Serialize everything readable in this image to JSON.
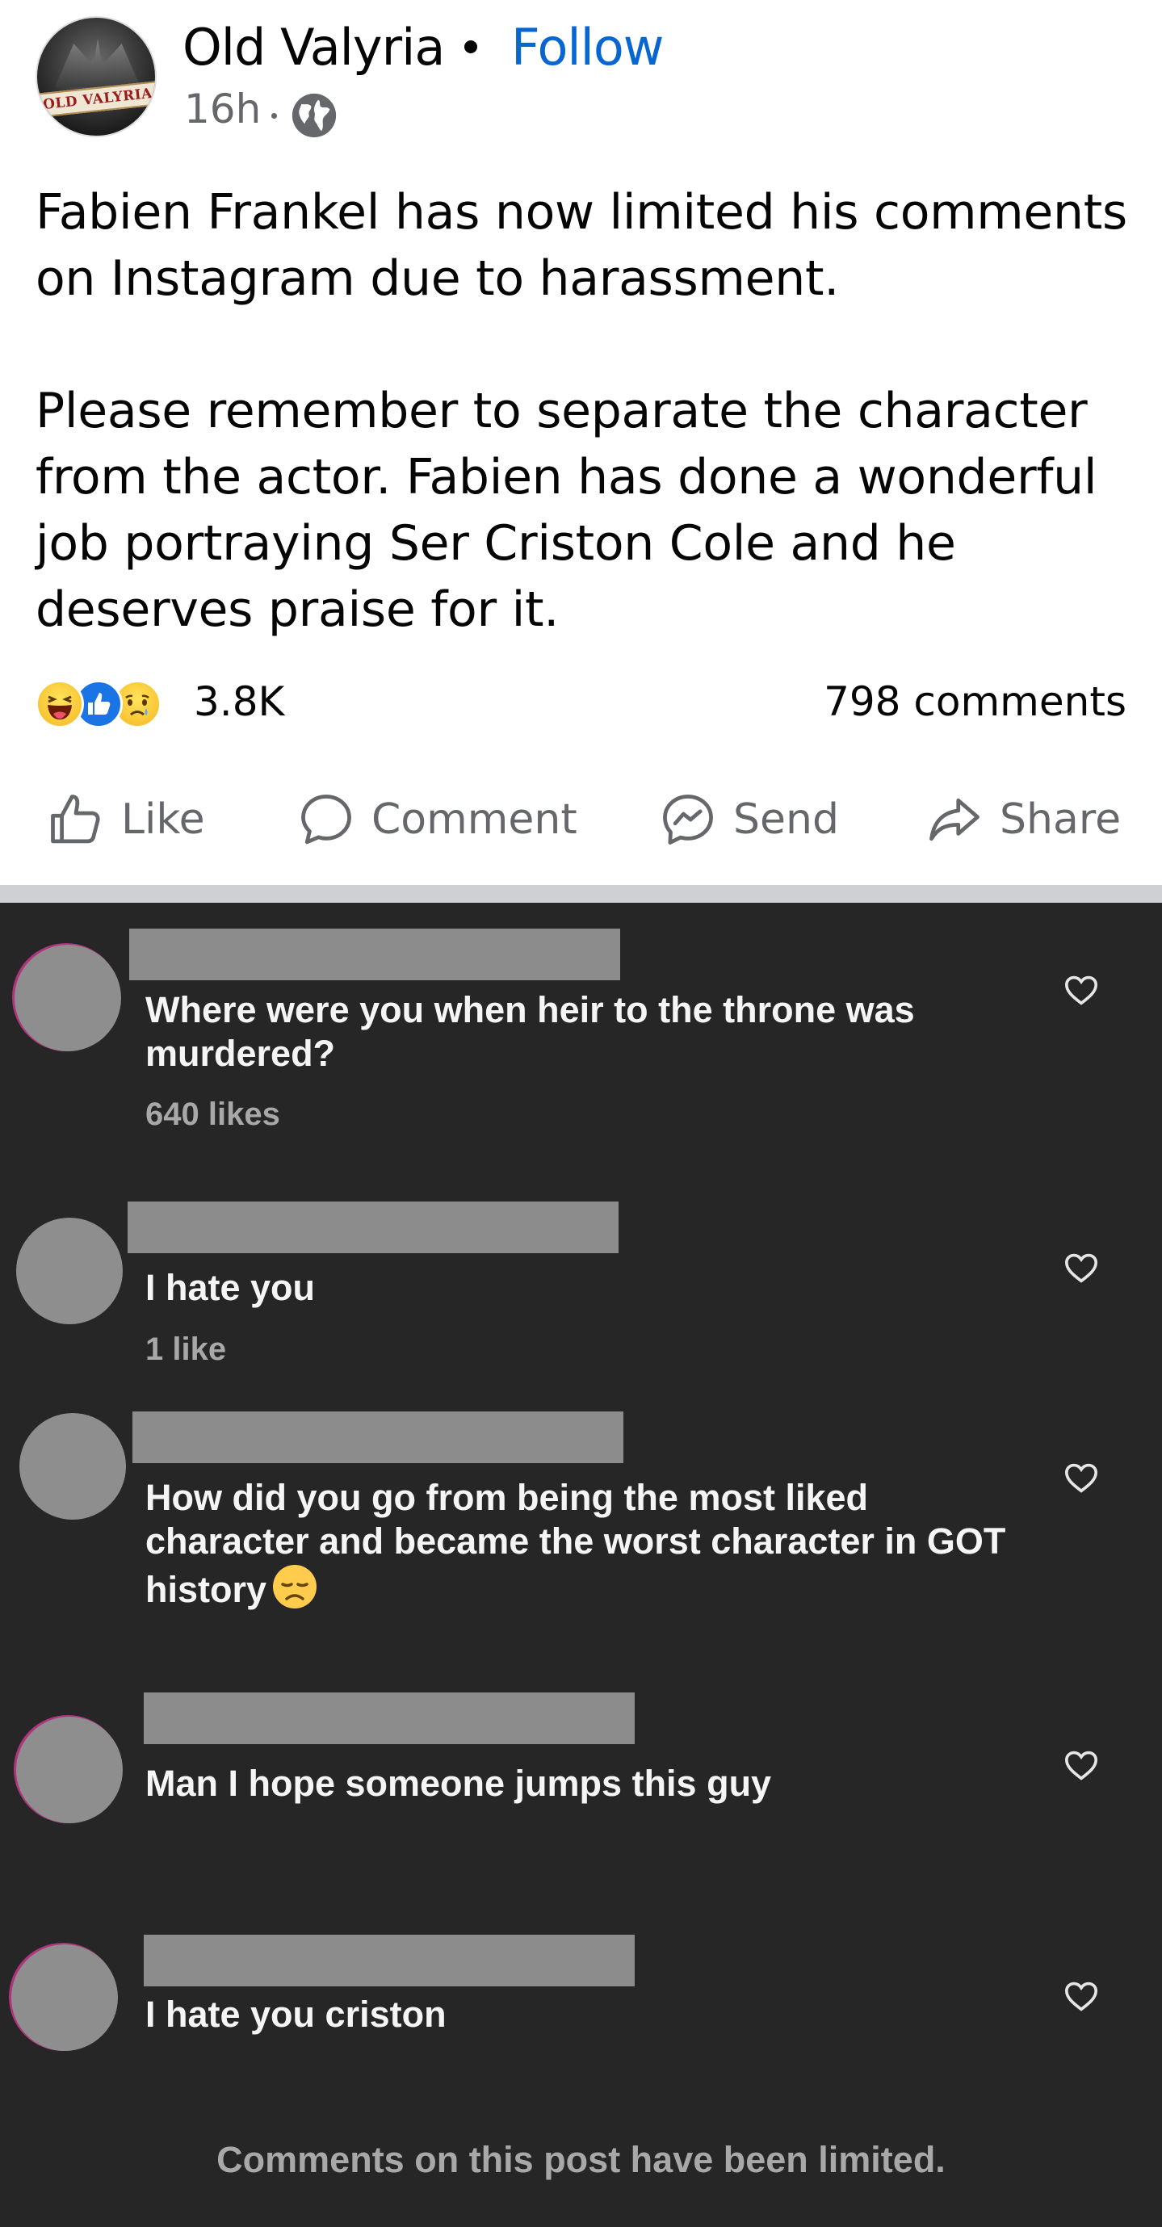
{
  "post": {
    "page_name": "Old Valyria",
    "avatar_text": "OLD VALYRIA",
    "separator": "•",
    "follow_label": "Follow",
    "timestamp": "16h",
    "visibility_icon": "globe-icon",
    "text": "Fabien Frankel has now limited his comments on Instagram due to harassment.\n\nPlease remember to separate the character from the actor. Fabien has done a wonderful job portraying Ser Criston Cole and he deserves praise for it.",
    "reactions": [
      "haha",
      "like",
      "sad"
    ],
    "reaction_count": "3.8K",
    "comment_count": "798 comments",
    "actions": {
      "like": "Like",
      "comment": "Comment",
      "send": "Send",
      "share": "Share"
    }
  },
  "instagram": {
    "comments": [
      {
        "text": "Where were you when heir to the throne was murdered?",
        "likes": "640 likes"
      },
      {
        "text": "I hate you",
        "likes": "1 like"
      },
      {
        "text": "How did you go from being the most liked character and became the worst character in GOT history",
        "emoji": "disappointed-face",
        "likes": ""
      },
      {
        "text": "Man I hope someone jumps this guy",
        "likes": ""
      },
      {
        "text": "I hate you criston",
        "likes": ""
      }
    ],
    "limited_notice": "Comments on this post have been limited."
  },
  "colors": {
    "follow_blue": "#0866d1",
    "ig_background": "#262626",
    "redaction_gray": "#8c8c8c",
    "divider": "#ced0d4"
  }
}
